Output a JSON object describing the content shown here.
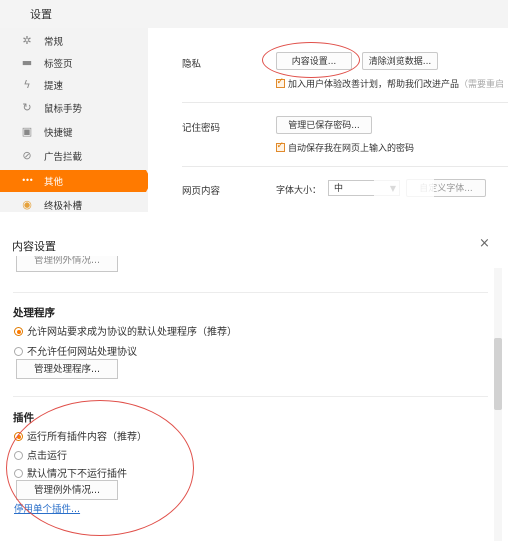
{
  "settings": {
    "title": "设置",
    "sidebar": [
      {
        "label": "常规",
        "icon": "gear-icon",
        "glyph": "✲"
      },
      {
        "label": "标签页",
        "icon": "tab-icon",
        "glyph": "▬"
      },
      {
        "label": "提速",
        "icon": "lightning-icon",
        "glyph": "ϟ"
      },
      {
        "label": "鼠标手势",
        "icon": "mouse-gesture-icon",
        "glyph": "↻"
      },
      {
        "label": "快捷键",
        "icon": "keyboard-icon",
        "glyph": "▣"
      },
      {
        "label": "广告拦截",
        "icon": "block-icon",
        "glyph": "⊘"
      },
      {
        "label": "其他",
        "icon": "more-icon",
        "glyph": "•••",
        "active": true
      },
      {
        "label": "终极补槽",
        "icon": "boost-icon",
        "glyph": "◉"
      }
    ],
    "privacy": {
      "label": "隐私",
      "content_settings_btn": "内容设置...",
      "clear_data_btn": "清除浏览数据...",
      "improve_checkbox": "加入用户体验改善计划，帮助我们改进产品",
      "improve_suffix": "（需要重启"
    },
    "passwords": {
      "label": "记住密码",
      "manage_btn": "管理已保存密码...",
      "autosave_checkbox": "自动保存我在网页上输入的密码"
    },
    "web_content": {
      "label": "网页内容",
      "font_size_label": "字体大小：",
      "font_size_value": "中",
      "custom_font_btn": "自定义字体..."
    }
  },
  "dialog": {
    "title": "内容设置",
    "close": "×",
    "top_button": "管理例外情况...",
    "handlers": {
      "title": "处理程序",
      "options": [
        "允许网站要求成为协议的默认处理程序（推荐）",
        "不允许任何网站处理协议"
      ],
      "selected": 0,
      "manage_btn": "管理处理程序..."
    },
    "plugins": {
      "title": "插件",
      "options": [
        "运行所有插件内容（推荐）",
        "点击运行",
        "默认情况下不运行插件"
      ],
      "selected": 0,
      "manage_btn": "管理例外情况...",
      "link": "停用单个插件..."
    }
  }
}
